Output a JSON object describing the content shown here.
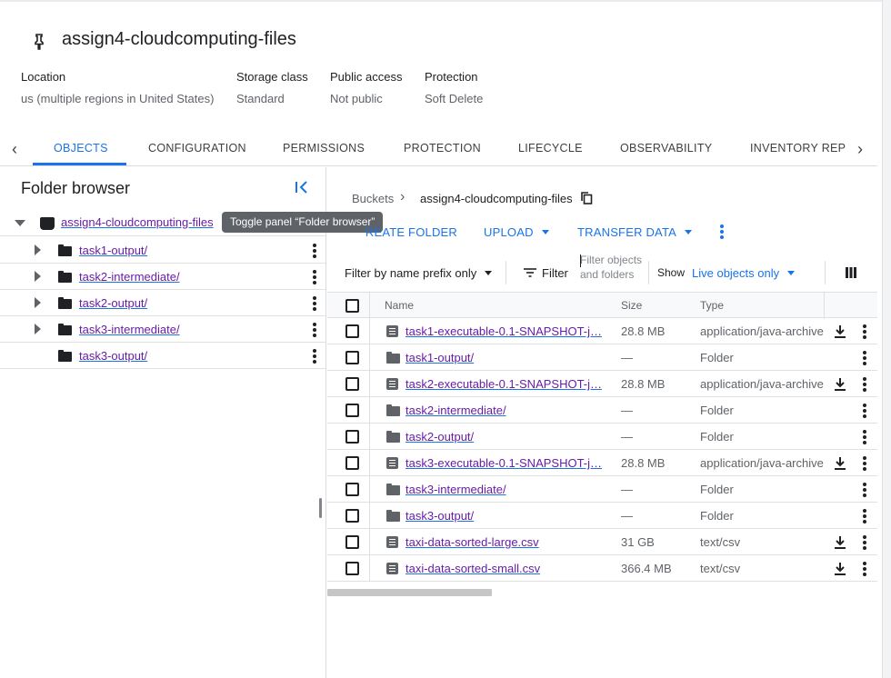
{
  "bucket": {
    "title": "assign4-cloudcomputing-files"
  },
  "meta": [
    {
      "key": "Location",
      "value": "us (multiple regions in United States)"
    },
    {
      "key": "Storage class",
      "value": "Standard"
    },
    {
      "key": "Public access",
      "value": "Not public"
    },
    {
      "key": "Protection",
      "value": "Soft Delete"
    }
  ],
  "tabs": [
    "OBJECTS",
    "CONFIGURATION",
    "PERMISSIONS",
    "PROTECTION",
    "LIFECYCLE",
    "OBSERVABILITY",
    "INVENTORY REPO"
  ],
  "folder_browser": {
    "title": "Folder browser",
    "tooltip": "Toggle panel “Folder browser”",
    "root": "assign4-cloudcomputing-files",
    "items": [
      "task1-output/",
      "task2-intermediate/",
      "task2-output/",
      "task3-intermediate/",
      "task3-output/"
    ]
  },
  "breadcrumb": {
    "root": "Buckets",
    "current": "assign4-cloudcomputing-files"
  },
  "actions": {
    "create_folder": "CREATE FOLDER",
    "upload": "UPLOAD",
    "transfer": "TRANSFER DATA"
  },
  "filterbar": {
    "prefix": "Filter by name prefix only",
    "filter": "Filter",
    "placeholder": "Filter objects and folders",
    "show": "Show",
    "show_value": "Live objects only"
  },
  "table": {
    "headers": {
      "name": "Name",
      "size": "Size",
      "type": "Type"
    },
    "rows": [
      {
        "name": "task1-executable-0.1-SNAPSHOT-j…",
        "size": "28.8 MB",
        "type": "application/java-archive"
      },
      {
        "name": "task1-output/",
        "size": "—",
        "type": "Folder"
      },
      {
        "name": "task2-executable-0.1-SNAPSHOT-j…",
        "size": "28.8 MB",
        "type": "application/java-archive"
      },
      {
        "name": "task2-intermediate/",
        "size": "—",
        "type": "Folder"
      },
      {
        "name": "task2-output/",
        "size": "—",
        "type": "Folder"
      },
      {
        "name": "task3-executable-0.1-SNAPSHOT-j…",
        "size": "28.8 MB",
        "type": "application/java-archive"
      },
      {
        "name": "task3-intermediate/",
        "size": "—",
        "type": "Folder"
      },
      {
        "name": "task3-output/",
        "size": "—",
        "type": "Folder"
      },
      {
        "name": "taxi-data-sorted-large.csv",
        "size": "31 GB",
        "type": "text/csv"
      },
      {
        "name": "taxi-data-sorted-small.csv",
        "size": "366.4 MB",
        "type": "text/csv"
      }
    ]
  },
  "icons": {
    "pin": "pin-icon",
    "bucket": "bucket-icon",
    "folder": "folder-icon",
    "file": "file-icon",
    "download": "download-icon",
    "more": "more-vert-icon",
    "copy": "copy-icon",
    "columns": "columns-icon",
    "filter": "filter-icon",
    "collapse": "collapse-panel-icon"
  },
  "colors": {
    "accent": "#1a73e8",
    "visited_link": "#681da8",
    "tooltip_bg": "#5f6368"
  }
}
